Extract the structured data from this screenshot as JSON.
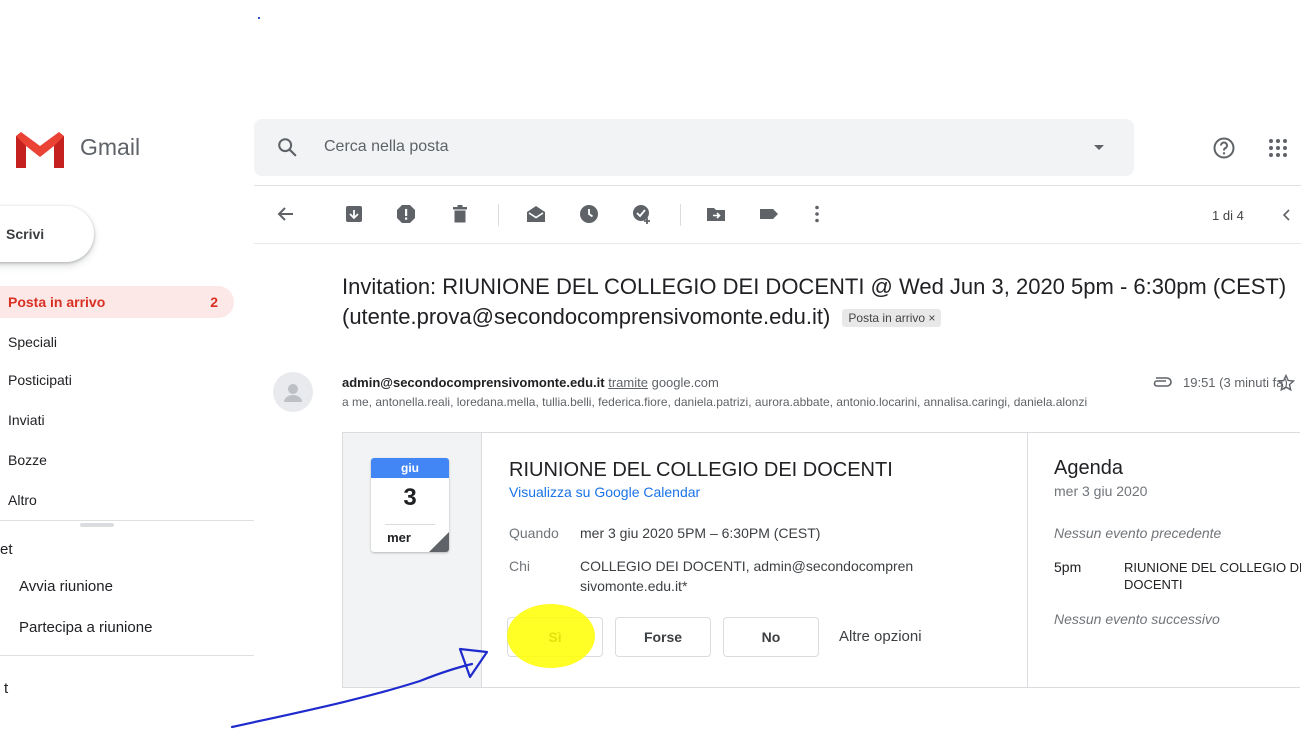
{
  "colors": {
    "gmail_red": "#ea4335",
    "active_bg": "#fce8e6",
    "active_text": "#d93025",
    "link": "#1a73e8",
    "calendar_blue": "#4285f4",
    "highlight_yellow": "#ffff00",
    "annotation_blue": "#1f2bcc"
  },
  "header": {
    "app_name": "Gmail",
    "search_placeholder": "Cerca nella posta",
    "icons": [
      "gmail-logo",
      "search-icon",
      "dropdown-caret-icon",
      "help-icon",
      "apps-grid-icon"
    ]
  },
  "sidebar": {
    "compose_label": "Scrivi",
    "items": [
      {
        "label": "Posta in arrivo",
        "count": "2",
        "active": true
      },
      {
        "label": "Speciali"
      },
      {
        "label": "Posticipati"
      },
      {
        "label": "Inviati"
      },
      {
        "label": "Bozze"
      },
      {
        "label": "Altro"
      }
    ],
    "meet_section_label": "et",
    "meet_items": [
      {
        "label": "Avvia riunione"
      },
      {
        "label": "Partecipa a riunione"
      }
    ],
    "hangouts_section_label": "t"
  },
  "toolbar": {
    "icons": [
      "back-arrow-icon",
      "archive-icon",
      "report-spam-icon",
      "delete-icon",
      "mark-unread-icon",
      "snooze-icon",
      "add-to-tasks-icon",
      "move-to-icon",
      "labels-icon",
      "more-vert-icon"
    ],
    "pager": "1 di 4"
  },
  "email": {
    "subject": "Invitation: RIUNIONE DEL COLLEGIO DEI DOCENTI @ Wed Jun 3, 2020 5pm - 6:30pm (CEST) (utente.prova@secondocomprensivomonte.edu.it)",
    "label_chip": "Posta in arrivo ×",
    "sender": "admin@secondocomprensivomonte.edu.it",
    "via_label": "tramite",
    "via_domain": "google.com",
    "time": "19:51 (3 minuti fa)",
    "recipients": "a me, antonella.reali, loredana.mella, tullia.belli, federica.fiore, daniela.patrizi, aurora.abbate, antonio.locarini, annalisa.caringi, daniela.alonzi"
  },
  "invite": {
    "cal_month": "giu",
    "cal_day": "3",
    "cal_dow": "mer",
    "title": "RIUNIONE DEL COLLEGIO DEI DOCENTI",
    "calendar_link": "Visualizza su Google Calendar",
    "when_label": "Quando",
    "when_value": "mer 3 giu 2020 5PM – 6:30PM (CEST)",
    "who_label": "Chi",
    "who_value_line1": "COLLEGIO DEI DOCENTI, admin@secondocompren",
    "who_value_line2": "sivomonte.edu.it*",
    "rsvp": {
      "yes": "Sì",
      "maybe": "Forse",
      "no": "No",
      "more": "Altre opzioni"
    }
  },
  "agenda": {
    "title": "Agenda",
    "date": "mer 3 giu 2020",
    "no_previous": "Nessun evento precedente",
    "event_time": "5pm",
    "event_name_line1": "RIUNIONE DEL COLLEGIO DEI",
    "event_name_line2": "DOCENTI",
    "no_next": "Nessun evento successivo"
  }
}
